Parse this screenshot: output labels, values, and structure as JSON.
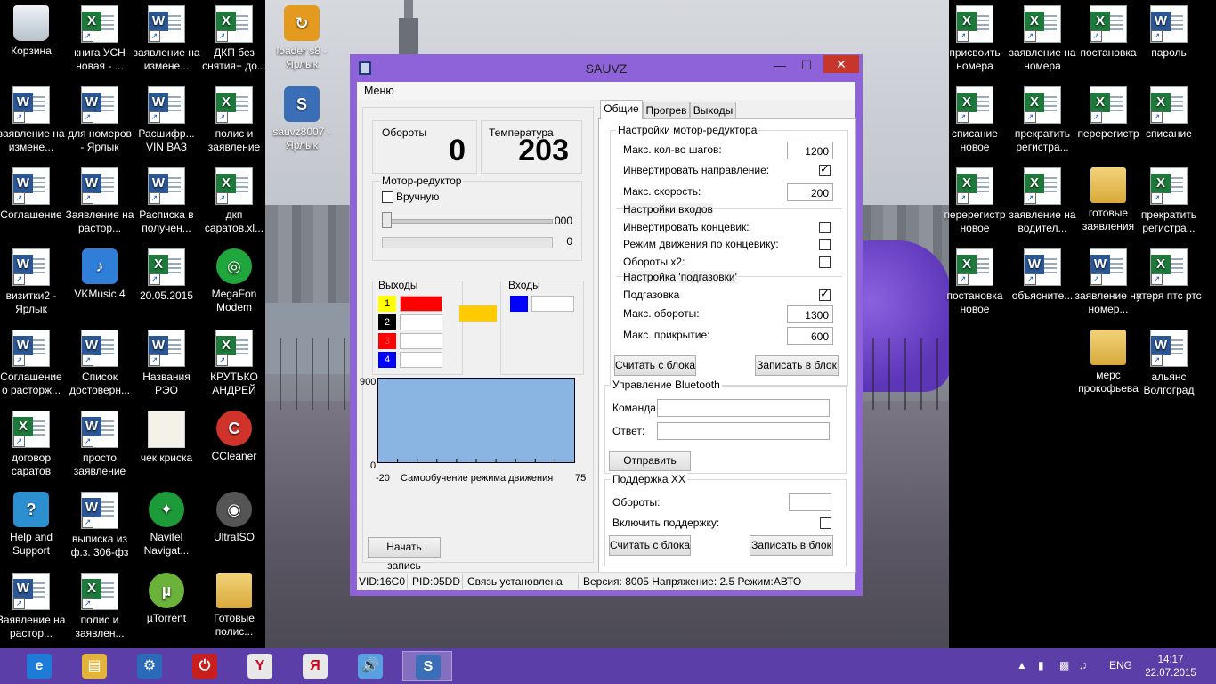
{
  "desktop": {
    "icons": [
      {
        "label": "Корзина",
        "kind": "bin"
      },
      {
        "label": "книга УСН новая - ...",
        "kind": "excel"
      },
      {
        "label": "заявление на измене...",
        "kind": "word"
      },
      {
        "label": "ДКП без снятия+ до...",
        "kind": "excel"
      },
      {
        "label": "loader s8 - Ярлык",
        "kind": "app"
      },
      {
        "label": "заявление на измене...",
        "kind": "word"
      },
      {
        "label": "для номеров - Ярлык",
        "kind": "word"
      },
      {
        "label": "Расшифр... VIN ВАЗ",
        "kind": "word"
      },
      {
        "label": "полис и заявление",
        "kind": "excel"
      },
      {
        "label": "sauvz8007 - Ярлык",
        "kind": "app"
      },
      {
        "label": "Соглашение",
        "kind": "word"
      },
      {
        "label": "Заявление на растор...",
        "kind": "word"
      },
      {
        "label": "Расписка в получен...",
        "kind": "word"
      },
      {
        "label": "дкп саратов.xl...",
        "kind": "excel"
      },
      {
        "label": "визитки2 - Ярлык",
        "kind": "word"
      },
      {
        "label": "VKMusic 4",
        "kind": "app"
      },
      {
        "label": "20.05.2015",
        "kind": "excel"
      },
      {
        "label": "MegaFon Modem",
        "kind": "round"
      },
      {
        "label": "Соглашение о расторж...",
        "kind": "word"
      },
      {
        "label": "Список достоверн...",
        "kind": "word"
      },
      {
        "label": "Названия РЭО",
        "kind": "word"
      },
      {
        "label": "КРУТЬКО АНДРЕЙ",
        "kind": "excel"
      },
      {
        "label": "договор саратов",
        "kind": "excel"
      },
      {
        "label": "просто заявление",
        "kind": "word"
      },
      {
        "label": "чек криска",
        "kind": "plain"
      },
      {
        "label": "CCleaner",
        "kind": "round"
      },
      {
        "label": "Help and Support",
        "kind": "app"
      },
      {
        "label": "выписка из ф.з. 306-фз",
        "kind": "word"
      },
      {
        "label": "Navitel Navigat...",
        "kind": "round"
      },
      {
        "label": "UltraISO",
        "kind": "round"
      },
      {
        "label": "Заявление на растор...",
        "kind": "word"
      },
      {
        "label": "полис и заявлен...",
        "kind": "excel"
      },
      {
        "label": "µTorrent",
        "kind": "round"
      },
      {
        "label": "Готовые полис...",
        "kind": "folder"
      },
      {
        "label": "присвоить номера",
        "kind": "excel"
      },
      {
        "label": "заявление на номера",
        "kind": "excel"
      },
      {
        "label": "постановка",
        "kind": "excel"
      },
      {
        "label": "пароль",
        "kind": "word"
      },
      {
        "label": "списание новое",
        "kind": "excel"
      },
      {
        "label": "прекратить регистра...",
        "kind": "excel"
      },
      {
        "label": "перерегистр",
        "kind": "excel"
      },
      {
        "label": "списание",
        "kind": "excel"
      },
      {
        "label": "перерегистр новое",
        "kind": "excel"
      },
      {
        "label": "заявление на водител...",
        "kind": "excel"
      },
      {
        "label": "готовые заявления",
        "kind": "folder"
      },
      {
        "label": "прекратить регистра...",
        "kind": "excel"
      },
      {
        "label": "постановка новое",
        "kind": "excel"
      },
      {
        "label": "объясните...",
        "kind": "word"
      },
      {
        "label": "заявление на номер...",
        "kind": "word"
      },
      {
        "label": "утеря птс ртс",
        "kind": "excel"
      },
      {
        "label": "мерс прокофьева",
        "kind": "folder"
      },
      {
        "label": "альянс Волгоград",
        "kind": "word"
      }
    ]
  },
  "window": {
    "title": "SAUVZ",
    "menu": "Меню",
    "rpm_label": "Обороты",
    "rpm_value": "0",
    "temp_label": "Температура",
    "temp_value": "203",
    "motor_group": "Мотор-редуктор",
    "manual_label": "Вручную",
    "slider_value": "000",
    "progress_value": "0",
    "outputs_label": "Выходы",
    "inputs_label": "Входы",
    "outputs": [
      {
        "num": "1",
        "num_color": "#ffff00",
        "bar_color": "#ff0000"
      },
      {
        "num": "2",
        "num_color": "#000000",
        "bar_color": "#ffffff"
      },
      {
        "num": "3",
        "num_color": "#ff0000",
        "bar_color": "#ffffff"
      },
      {
        "num": "4",
        "num_color": "#0000ff",
        "bar_color": "#ffffff"
      }
    ],
    "indicator_color": "#ffcc00",
    "input_swatch_color": "#0000ff",
    "chart": {
      "ymax": "900",
      "ymin": "0",
      "xmin": "-20",
      "xmax": "75",
      "xlabel": "Самообучение режима движения"
    },
    "record_button": "Начать запись",
    "tabs": [
      "Общие",
      "Прогрев",
      "Выходы"
    ],
    "motor_settings": {
      "title": "Настройки мотор-редуктора",
      "max_steps_label": "Макс. кол-во шагов:",
      "max_steps": "1200",
      "invert_dir_label": "Инвертировать направление:",
      "max_speed_label": "Макс. скорость:",
      "max_speed": "200"
    },
    "input_settings": {
      "title": "Настройки входов",
      "invert_limit_label": "Инвертировать концевик:",
      "limit_mode_label": "Режим движения по концевику:",
      "rpm_x2_label": "Обороты x2:"
    },
    "gas_settings": {
      "title": "Настройка 'подгазовки'",
      "enable_label": "Подгазовка",
      "max_rpm_label": "Макс. обороты:",
      "max_rpm": "1300",
      "max_close_label": "Макс. прикрытие:",
      "max_close": "600"
    },
    "read_button": "Считать с блока",
    "write_button": "Записать в блок",
    "bluetooth": {
      "title": "Управление Bluetooth",
      "command_label": "Команда:",
      "answer_label": "Ответ:",
      "send_button": "Отправить"
    },
    "idle": {
      "title": "Поддержка ХХ",
      "rpm_label": "Обороты:",
      "enable_label": "Включить поддержку:"
    },
    "status": {
      "vid": "VID:16C0",
      "pid": "PID:05DD",
      "link": "Связь установлена",
      "info": "Версия: 8005 Напряжение: 2.5 Режим:АВТО"
    }
  },
  "taskbar": {
    "apps": [
      "ie-icon",
      "explorer-icon",
      "control-panel-icon",
      "shutdown-icon",
      "yandex-browser-icon",
      "yandex-icon",
      "sound-icon",
      "sauvz-icon"
    ],
    "lang": "ENG",
    "time": "14:17",
    "date": "22.07.2015"
  }
}
